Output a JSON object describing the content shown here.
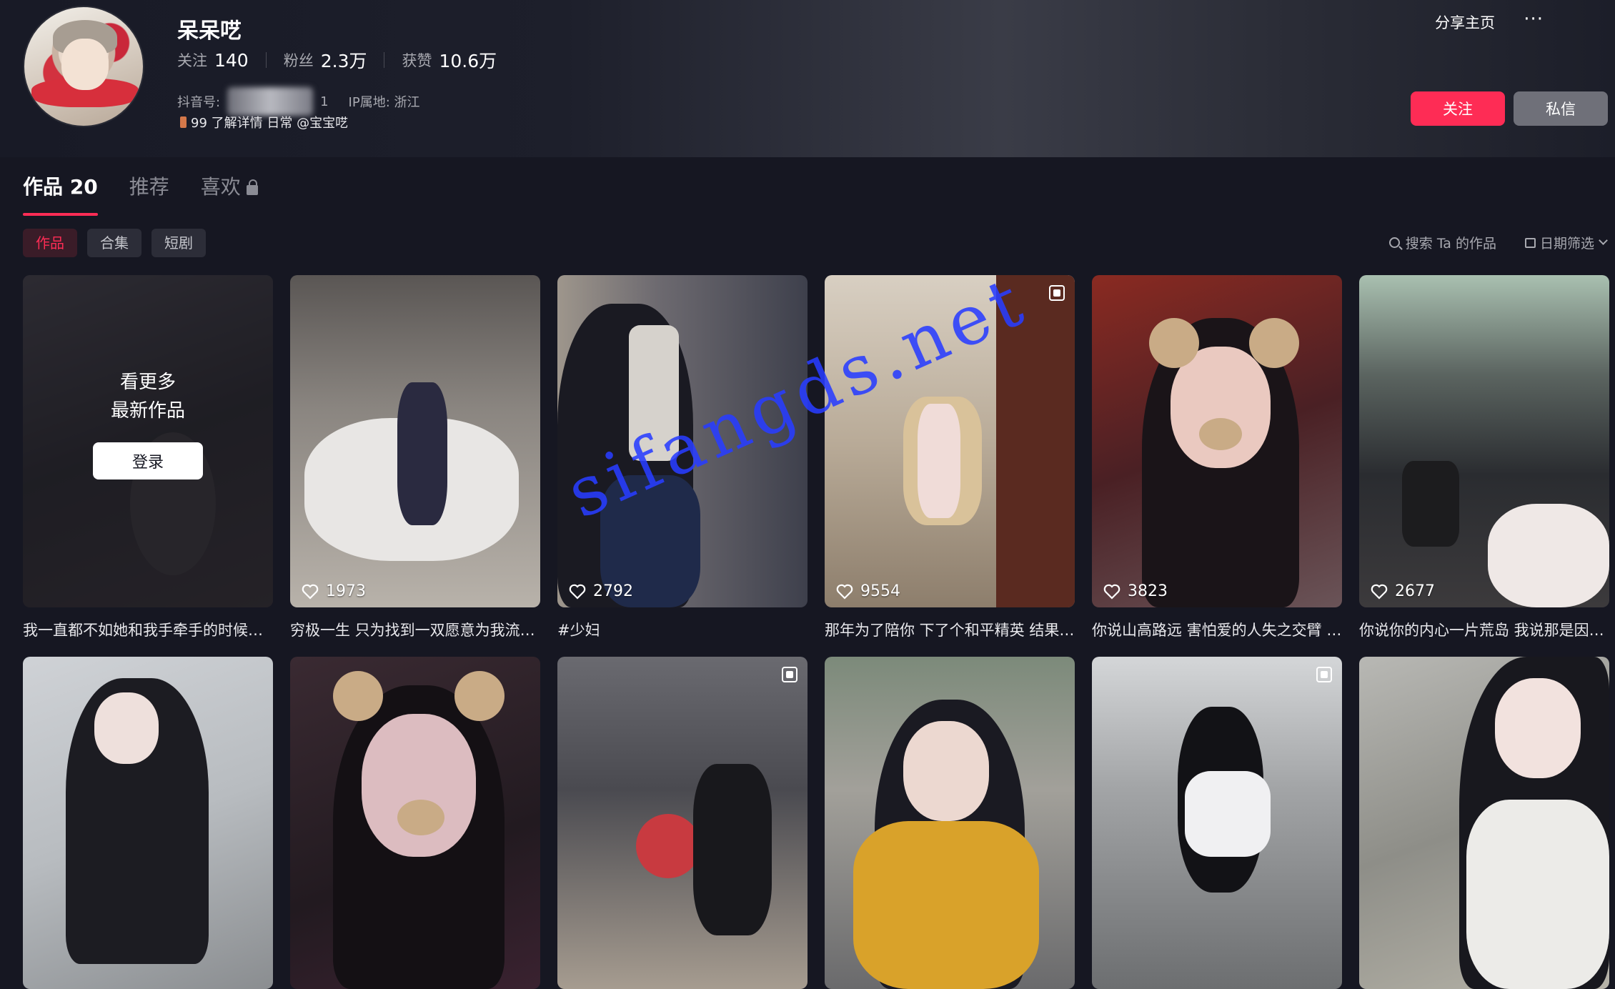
{
  "profile": {
    "name": "呆呆呓",
    "stats": [
      {
        "label": "关注",
        "value": "140"
      },
      {
        "label": "粉丝",
        "value": "2.3万"
      },
      {
        "label": "获赞",
        "value": "10.6万"
      }
    ],
    "douyin_id_label": "抖音号:",
    "douyin_id_partial": "1",
    "ip_label": "IP属地: 浙江",
    "bio": "99 了解详情 日常 @宝宝呓"
  },
  "header_actions": {
    "share_label": "分享主页",
    "more_label": "···",
    "follow_label": "关注",
    "message_label": "私信"
  },
  "tabs": [
    {
      "label": "作品 20"
    },
    {
      "label": "推荐"
    },
    {
      "label": "喜欢"
    }
  ],
  "filters": [
    {
      "label": "作品"
    },
    {
      "label": "合集"
    },
    {
      "label": "短剧"
    }
  ],
  "tools": {
    "search_label": "搜索 Ta 的作品",
    "date_filter_label": "日期筛选"
  },
  "login_overlay": {
    "line1": "看更多",
    "line2": "最新作品",
    "button": "登录"
  },
  "videos_row1": [
    {
      "caption": "我一直都不如她和我手牵手的时候…",
      "likes": ""
    },
    {
      "caption": "穷极一生 只为找到一双愿意为我流…",
      "likes": "1973"
    },
    {
      "caption": "#少妇",
      "likes": "2792"
    },
    {
      "caption": "那年为了陪你 下了个和平精英 结果…",
      "likes": "9554"
    },
    {
      "caption": "你说山高路远 害怕爱的人失之交臂 …",
      "likes": "3823"
    },
    {
      "caption": "你说你的内心一片荒岛 我说那是因…",
      "likes": "2677"
    }
  ],
  "watermark": "sifangds.net"
}
